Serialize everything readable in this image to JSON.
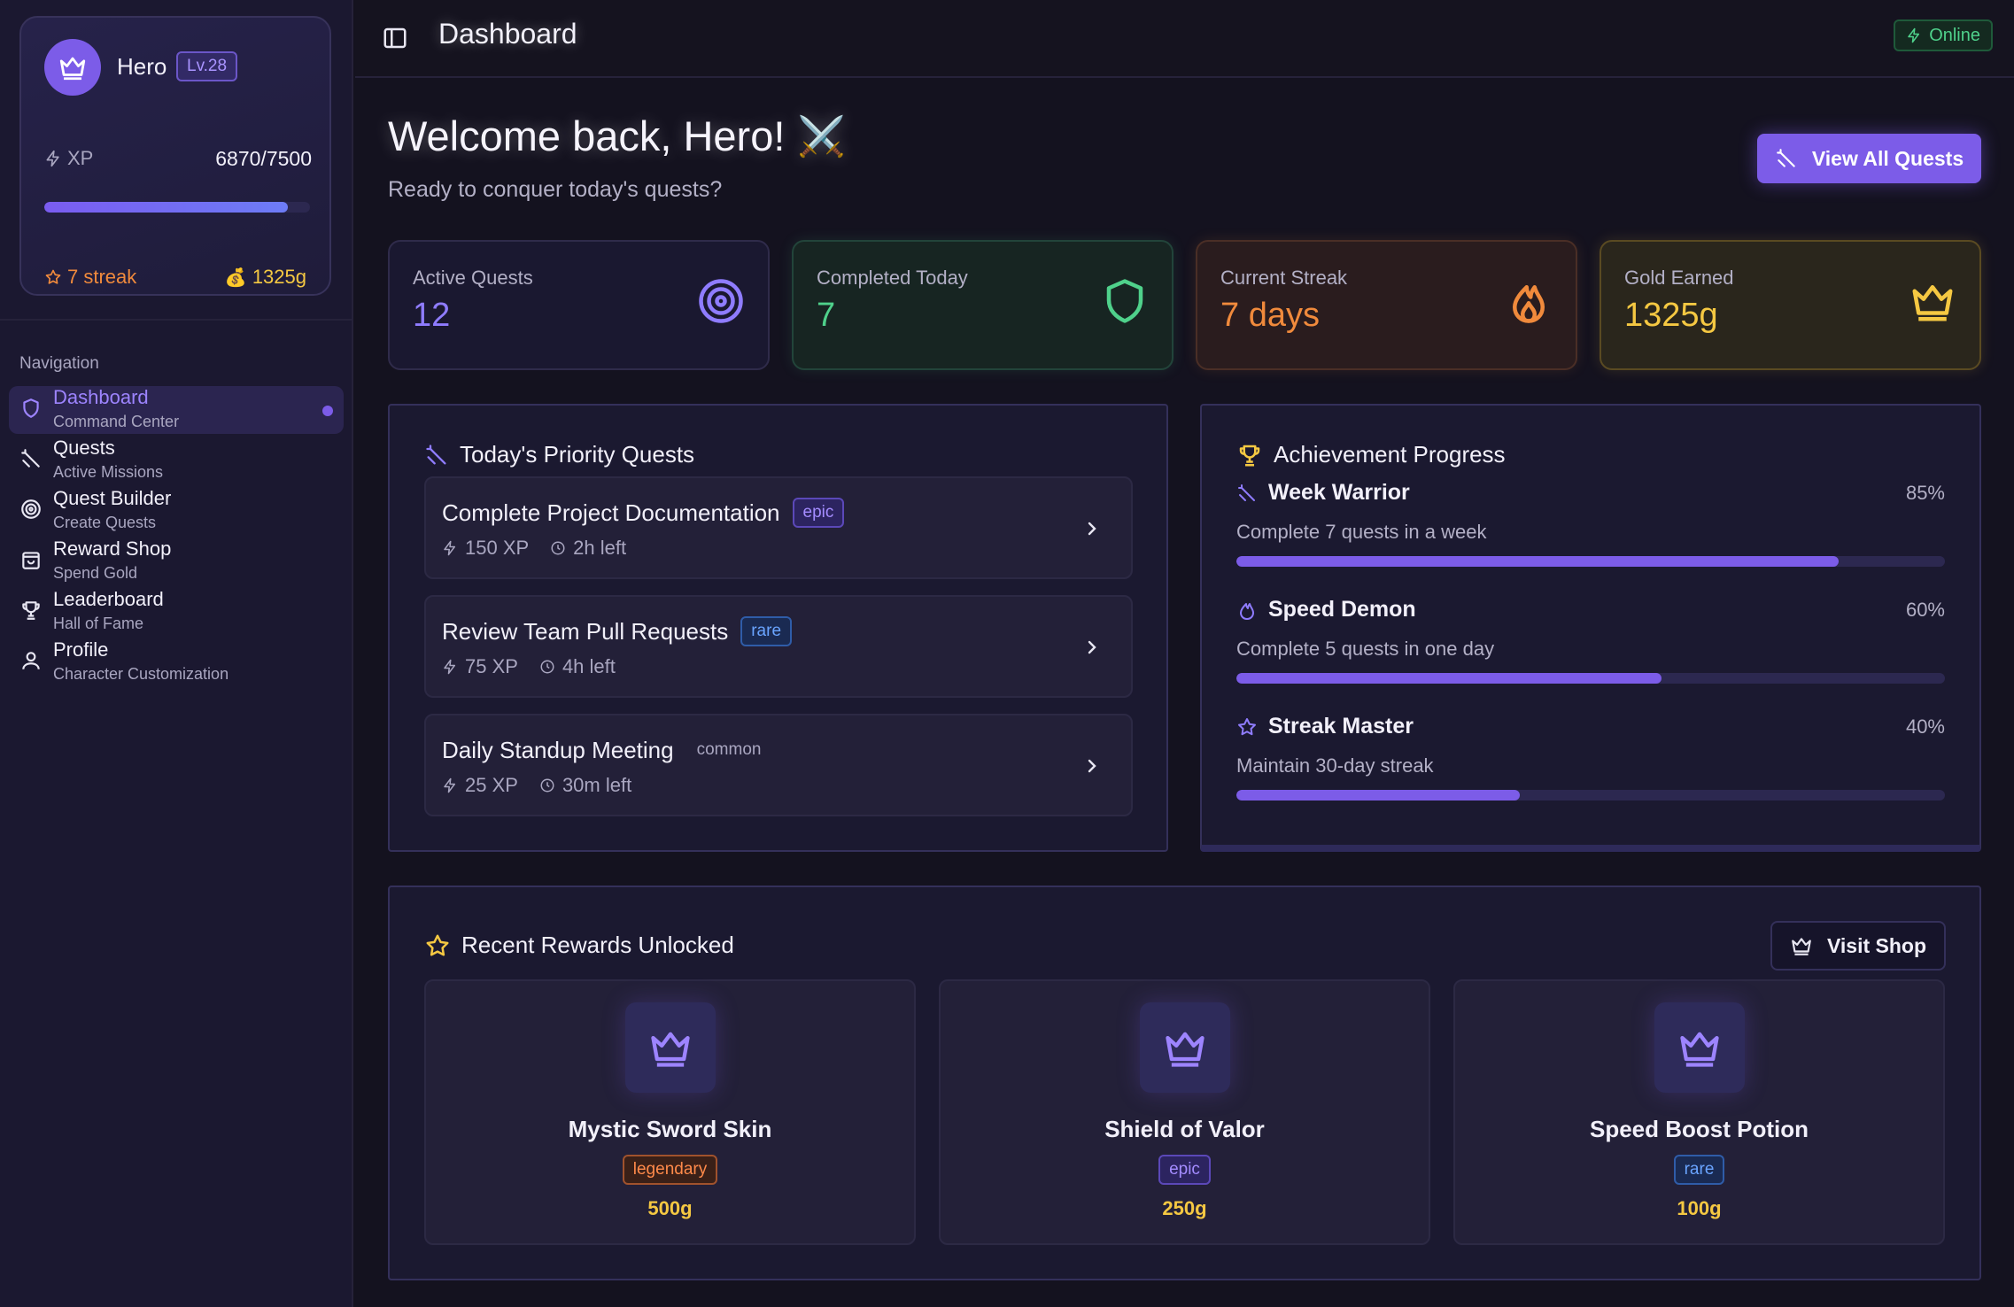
{
  "sidebar": {
    "profile": {
      "name": "Hero",
      "level": "Lv.28",
      "xp_label": "XP",
      "xp_value": "6870/7500",
      "xp_progress": 0.916,
      "streak": "7 streak",
      "gold": "1325g"
    },
    "nav_heading": "Navigation",
    "items": [
      {
        "title": "Dashboard",
        "subtitle": "Command Center",
        "icon": "shield-icon",
        "active": true
      },
      {
        "title": "Quests",
        "subtitle": "Active Missions",
        "icon": "sword-icon",
        "active": false
      },
      {
        "title": "Quest Builder",
        "subtitle": "Create Quests",
        "icon": "target-icon",
        "active": false
      },
      {
        "title": "Reward Shop",
        "subtitle": "Spend Gold",
        "icon": "bag-icon",
        "active": false
      },
      {
        "title": "Leaderboard",
        "subtitle": "Hall of Fame",
        "icon": "trophy-icon",
        "active": false
      },
      {
        "title": "Profile",
        "subtitle": "Character Customization",
        "icon": "user-icon",
        "active": false
      }
    ]
  },
  "header": {
    "title": "Dashboard",
    "status": "Online"
  },
  "main": {
    "welcome": "Welcome back, Hero!",
    "welcome_emoji": "⚔️",
    "subtitle": "Ready to conquer today's quests?",
    "view_all_label": "View All Quests",
    "stats": [
      {
        "label": "Active Quests",
        "value": "12",
        "color": "#8f7cff",
        "icon": "target-icon"
      },
      {
        "label": "Completed Today",
        "value": "7",
        "color": "#4fd18b",
        "icon": "shield-icon"
      },
      {
        "label": "Current Streak",
        "value": "7 days",
        "color": "#f08a3c",
        "icon": "flame-icon"
      },
      {
        "label": "Gold Earned",
        "value": "1325g",
        "color": "#f5c842",
        "icon": "crown-icon"
      }
    ],
    "priority": {
      "title": "Today's Priority Quests",
      "quests": [
        {
          "name": "Complete Project Documentation",
          "tag": "epic",
          "xp": "150 XP",
          "time": "2h left"
        },
        {
          "name": "Review Team Pull Requests",
          "tag": "rare",
          "xp": "75 XP",
          "time": "4h left"
        },
        {
          "name": "Daily Standup Meeting",
          "tag": "common",
          "xp": "25 XP",
          "time": "30m left"
        }
      ]
    },
    "achievements": {
      "title": "Achievement Progress",
      "items": [
        {
          "name": "Week Warrior",
          "percent": "85%",
          "progress": 0.85,
          "desc": "Complete 7 quests in a week",
          "icon": "sword-icon"
        },
        {
          "name": "Speed Demon",
          "percent": "60%",
          "progress": 0.6,
          "desc": "Complete 5 quests in one day",
          "icon": "flame-icon"
        },
        {
          "name": "Streak Master",
          "percent": "40%",
          "progress": 0.4,
          "desc": "Maintain 30-day streak",
          "icon": "star-icon"
        }
      ]
    },
    "rewards": {
      "title": "Recent Rewards Unlocked",
      "visit_shop_label": "Visit Shop",
      "items": [
        {
          "name": "Mystic Sword Skin",
          "tag": "legendary",
          "price": "500g"
        },
        {
          "name": "Shield of Valor",
          "tag": "epic",
          "price": "250g"
        },
        {
          "name": "Speed Boost Potion",
          "tag": "rare",
          "price": "100g"
        }
      ]
    }
  }
}
